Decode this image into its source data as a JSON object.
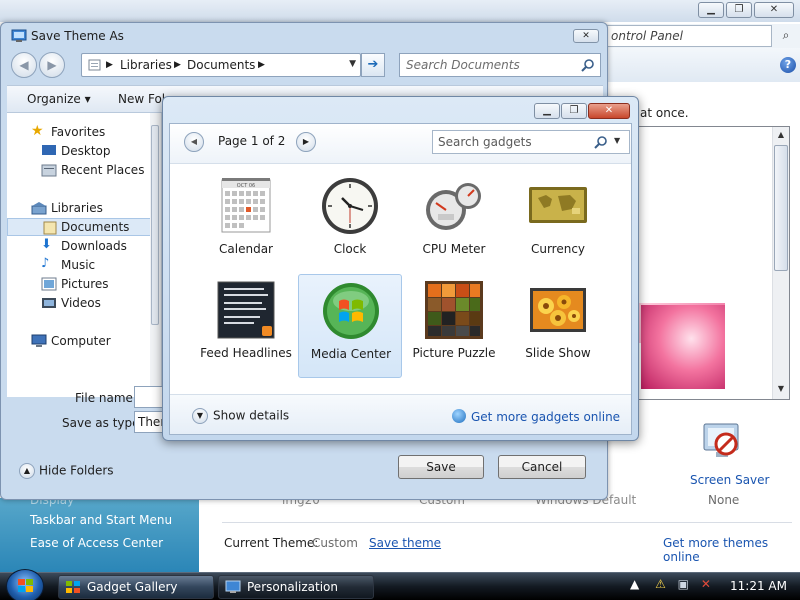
{
  "background_window": {
    "address_text": "ontrol Panel",
    "description_fragment": "at once.",
    "screen_saver": {
      "label": "Screen Saver",
      "value": "None"
    },
    "theme_row": [
      "img20",
      "Custom",
      "Windows Default"
    ],
    "left_links": [
      "Display",
      "Taskbar and Start Menu",
      "Ease of Access Center"
    ],
    "current_theme_label": "Current Theme:",
    "current_theme_value": "Custom",
    "save_theme_link": "Save theme",
    "get_more_themes": "Get more themes online",
    "help_glyph": "?"
  },
  "save_dialog": {
    "title": "Save Theme As",
    "close_glyph": "✕",
    "breadcrumb": [
      "Libraries",
      "Documents"
    ],
    "search_placeholder": "Search Documents",
    "toolbar": {
      "organize": "Organize ▾",
      "new_folder": "New Fol"
    },
    "nav": [
      {
        "label": "Favorites",
        "icon": "star-icon"
      },
      {
        "label": "Desktop",
        "icon": "desktop-icon"
      },
      {
        "label": "Recent Places",
        "icon": "recent-places-icon"
      },
      {
        "label": "Libraries",
        "icon": "libraries-icon"
      },
      {
        "label": "Documents",
        "icon": "documents-icon"
      },
      {
        "label": "Downloads",
        "icon": "downloads-icon"
      },
      {
        "label": "Music",
        "icon": "music-icon"
      },
      {
        "label": "Pictures",
        "icon": "pictures-icon"
      },
      {
        "label": "Videos",
        "icon": "videos-icon"
      },
      {
        "label": "Computer",
        "icon": "computer-icon"
      }
    ],
    "file_name_label": "File name:",
    "save_as_type_label": "Save as type:",
    "save_as_type_value": "Ther",
    "hide_folders": "Hide Folders",
    "save_button": "Save",
    "cancel_button": "Cancel"
  },
  "gadget_gallery": {
    "page_label": "Page 1 of 2",
    "search_placeholder": "Search gadgets",
    "gadgets": [
      {
        "label": "Calendar",
        "icon": "calendar-icon"
      },
      {
        "label": "Clock",
        "icon": "clock-icon"
      },
      {
        "label": "CPU Meter",
        "icon": "cpu-meter-icon"
      },
      {
        "label": "Currency",
        "icon": "currency-icon"
      },
      {
        "label": "Feed Headlines",
        "icon": "feed-headlines-icon"
      },
      {
        "label": "Media Center",
        "icon": "media-center-icon",
        "selected": true
      },
      {
        "label": "Picture Puzzle",
        "icon": "picture-puzzle-icon"
      },
      {
        "label": "Slide Show",
        "icon": "slide-show-icon"
      }
    ],
    "calendar_month": "OCT 06",
    "show_details": "Show details",
    "get_more_online": "Get more gadgets online"
  },
  "taskbar": {
    "tasks": [
      {
        "label": "Gadget Gallery",
        "active": true
      },
      {
        "label": "Personalization",
        "active": false
      }
    ],
    "clock": "11:21 AM"
  }
}
